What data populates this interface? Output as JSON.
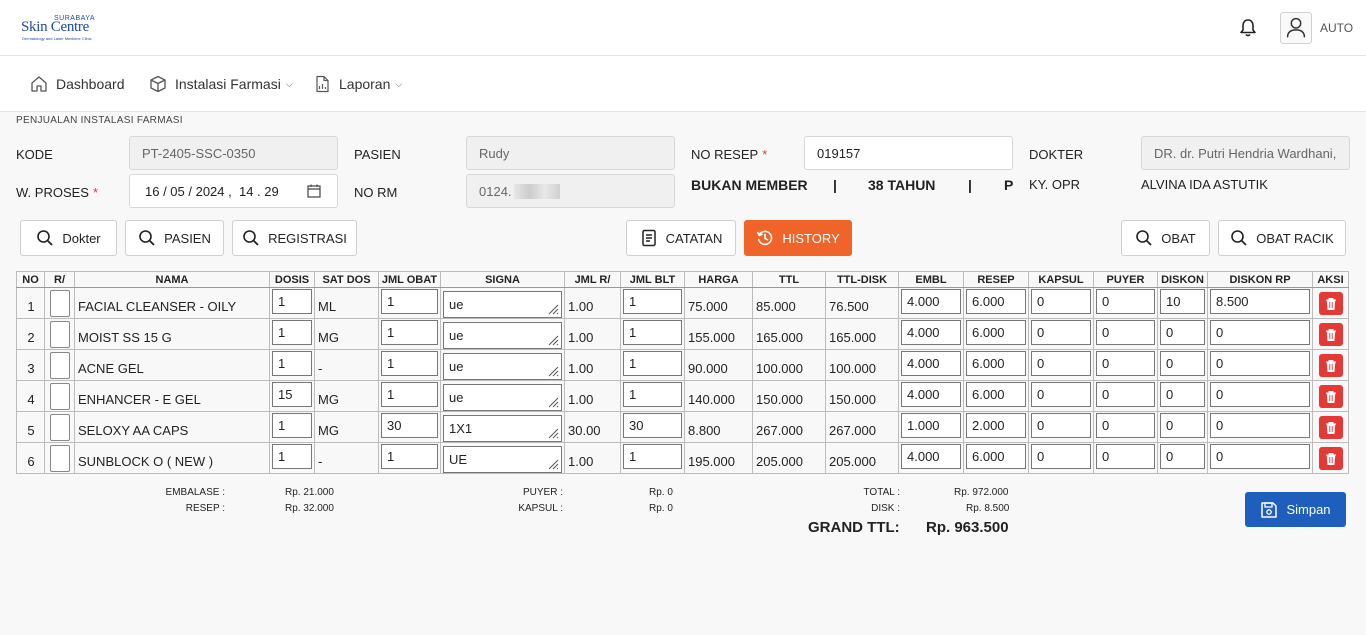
{
  "app": {
    "logo_top": "SURABAYA",
    "logo_main": "Skin Centre",
    "logo_sub": "Dermatology and Laser Medicine Clinic",
    "username": "AUTO"
  },
  "nav": [
    {
      "label": "Dashboard",
      "icon": "home-icon"
    },
    {
      "label": "Instalasi Farmasi",
      "icon": "box-icon"
    },
    {
      "label": "Laporan",
      "icon": "document-icon"
    }
  ],
  "section_title": "PENJUALAN INSTALASI FARMASI",
  "form": {
    "kode_label": "KODE",
    "kode_value": "PT-2405-SSC-0350",
    "pasien_label": "PASIEN",
    "pasien_value": "Rudy",
    "noresep_label": "NO RESEP",
    "noresep_value": "019157",
    "dokter_label": "DOKTER",
    "dokter_value": "DR. dr. Putri Hendria Wardhani,",
    "wproses_label": "W. PROSES",
    "wproses_value": "16 / 05 / 2024 ,  14 . 29",
    "norm_label": "NO RM",
    "norm_value": "0124.",
    "member_status": "BUKAN MEMBER",
    "sep1": "|",
    "age": "38 TAHUN",
    "sep2": "|",
    "gender": "P",
    "kyopr_label": "KY. OPR",
    "kyopr_value": "ALVINA IDA ASTUTIK",
    "required_mark": "*"
  },
  "buttons": {
    "dokter": "Dokter",
    "pasien": "PASIEN",
    "registrasi": "REGISTRASI",
    "catatan": "CATATAN",
    "history": "HISTORY",
    "obat": "OBAT",
    "obat_racik": "OBAT RACIK",
    "simpan": "Simpan"
  },
  "table": {
    "headers": [
      "NO",
      "R/",
      "NAMA",
      "DOSIS",
      "SAT DOS",
      "JML OBAT",
      "SIGNA",
      "JML R/",
      "JML BLT",
      "HARGA",
      "TTL",
      "TTL-DISK",
      "EMBL",
      "RESEP",
      "KAPSUL",
      "PUYER",
      "DISKON",
      "DISKON RP",
      "AKSI"
    ],
    "rows": [
      {
        "no": "1",
        "nama": "FACIAL CLEANSER - OILY",
        "dosis": "1",
        "satdos": "ML",
        "jml_obat": "1",
        "signa": "ue",
        "jml_r": "1.00",
        "jml_blt": "1",
        "harga": "75.000",
        "ttl": "85.000",
        "ttl_disk": "76.500",
        "embl": "4.000",
        "resep": "6.000",
        "kapsul": "0",
        "puyer": "0",
        "diskon": "10",
        "diskon_rp": "8.500"
      },
      {
        "no": "2",
        "nama": "MOIST SS 15 G",
        "dosis": "1",
        "satdos": "MG",
        "jml_obat": "1",
        "signa": "ue",
        "jml_r": "1.00",
        "jml_blt": "1",
        "harga": "155.000",
        "ttl": "165.000",
        "ttl_disk": "165.000",
        "embl": "4.000",
        "resep": "6.000",
        "kapsul": "0",
        "puyer": "0",
        "diskon": "0",
        "diskon_rp": "0"
      },
      {
        "no": "3",
        "nama": "ACNE GEL",
        "dosis": "1",
        "satdos": "-",
        "jml_obat": "1",
        "signa": "ue",
        "jml_r": "1.00",
        "jml_blt": "1",
        "harga": "90.000",
        "ttl": "100.000",
        "ttl_disk": "100.000",
        "embl": "4.000",
        "resep": "6.000",
        "kapsul": "0",
        "puyer": "0",
        "diskon": "0",
        "diskon_rp": "0"
      },
      {
        "no": "4",
        "nama": "ENHANCER - E GEL",
        "dosis": "15",
        "satdos": "MG",
        "jml_obat": "1",
        "signa": "ue",
        "jml_r": "1.00",
        "jml_blt": "1",
        "harga": "140.000",
        "ttl": "150.000",
        "ttl_disk": "150.000",
        "embl": "4.000",
        "resep": "6.000",
        "kapsul": "0",
        "puyer": "0",
        "diskon": "0",
        "diskon_rp": "0"
      },
      {
        "no": "5",
        "nama": "SELOXY AA CAPS",
        "dosis": "1",
        "satdos": "MG",
        "jml_obat": "30",
        "signa": "1X1",
        "jml_r": "30.00",
        "jml_blt": "30",
        "harga": "8.800",
        "ttl": "267.000",
        "ttl_disk": "267.000",
        "embl": "1.000",
        "resep": "2.000",
        "kapsul": "0",
        "puyer": "0",
        "diskon": "0",
        "diskon_rp": "0"
      },
      {
        "no": "6",
        "nama": "SUNBLOCK O ( NEW )",
        "dosis": "1",
        "satdos": "-",
        "jml_obat": "1",
        "signa": "UE",
        "jml_r": "1.00",
        "jml_blt": "1",
        "harga": "195.000",
        "ttl": "205.000",
        "ttl_disk": "205.000",
        "embl": "4.000",
        "resep": "6.000",
        "kapsul": "0",
        "puyer": "0",
        "diskon": "0",
        "diskon_rp": "0"
      }
    ]
  },
  "totals": {
    "embalase_label": "EMBALASE :",
    "embalase_value": "Rp. 21.000",
    "resep_label": "RESEP :",
    "resep_value": "Rp. 32.000",
    "puyer_label": "PUYER :",
    "puyer_value": "Rp. 0",
    "kapsul_label": "KAPSUL :",
    "kapsul_value": "Rp. 0",
    "total_label": "TOTAL :",
    "total_value": "Rp. 972.000",
    "disk_label": "DISK :",
    "disk_value": "Rp. 8.500",
    "grand_label": "GRAND TTL:",
    "grand_value": "Rp. 963.500"
  },
  "colors": {
    "history_button": "#f0642a",
    "save_button": "#1e5fbd",
    "delete_button": "#e53935",
    "logo": "#1f4aa8"
  }
}
